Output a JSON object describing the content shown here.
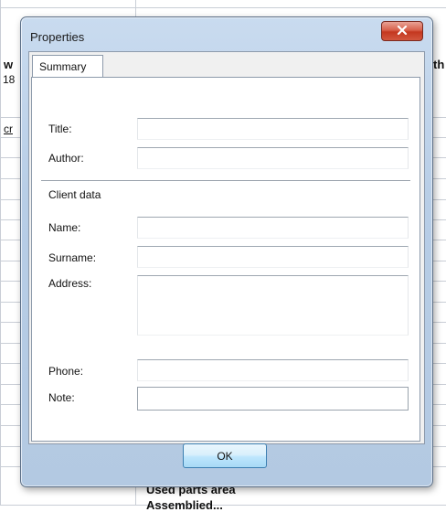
{
  "background": {
    "fragments": [
      {
        "name": "bg-text-w",
        "text": "w"
      },
      {
        "name": "bg-text-18",
        "text": "18"
      },
      {
        "name": "bg-text-cr",
        "text": "cr"
      },
      {
        "name": "bg-text-th",
        "text": "th"
      }
    ],
    "bottom_heading": "Used parts area",
    "bottom_subtext": "Assemblied..."
  },
  "dialog": {
    "title": "Properties",
    "close_icon": "close-x-icon",
    "tab_label": "Summary",
    "fields": {
      "title_label": "Title:",
      "title_value": "",
      "author_label": "Author:",
      "author_value": "",
      "section_label": "Client data",
      "name_label": "Name:",
      "name_value": "",
      "surname_label": "Surname:",
      "surname_value": "",
      "address_label": "Address:",
      "address_value": "",
      "phone_label": "Phone:",
      "phone_value": "",
      "note_label": "Note:",
      "note_value": ""
    },
    "ok_label": "OK"
  }
}
